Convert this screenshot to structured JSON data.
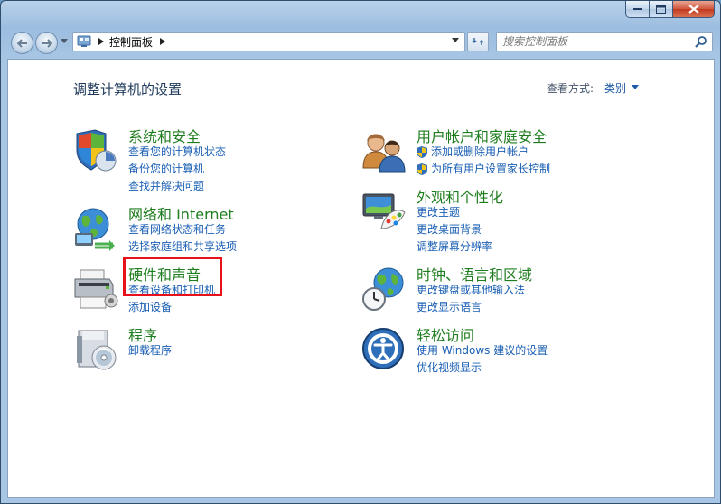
{
  "window": {
    "caption_buttons": [
      "minimize",
      "maximize",
      "close"
    ],
    "accent_close": "#c2391f"
  },
  "address_bar": {
    "breadcrumb": "控制面板"
  },
  "search": {
    "placeholder": "搜索控制面板"
  },
  "header": {
    "title": "调整计算机的设置",
    "view_label": "查看方式:",
    "view_value": "类别"
  },
  "categories_left": [
    {
      "title": "系统和安全",
      "icon": "system-security-icon",
      "links": [
        "查看您的计算机状态",
        "备份您的计算机",
        "查找并解决问题"
      ]
    },
    {
      "title": "网络和 Internet",
      "icon": "network-internet-icon",
      "links": [
        "查看网络状态和任务",
        "选择家庭组和共享选项"
      ]
    },
    {
      "title": "硬件和声音",
      "icon": "hardware-sound-icon",
      "links": [
        "查看设备和打印机",
        "添加设备"
      ]
    },
    {
      "title": "程序",
      "icon": "programs-icon",
      "links": [
        "卸载程序"
      ]
    }
  ],
  "categories_right": [
    {
      "title": "用户帐户和家庭安全",
      "icon": "user-accounts-icon",
      "links": [
        "添加或删除用户帐户",
        "为所有用户设置家长控制"
      ]
    },
    {
      "title": "外观和个性化",
      "icon": "appearance-icon",
      "links": [
        "更改主题",
        "更改桌面背景",
        "调整屏幕分辨率"
      ]
    },
    {
      "title": "时钟、语言和区域",
      "icon": "clock-language-region-icon",
      "links": [
        "更改键盘或其他输入法",
        "更改显示语言"
      ]
    },
    {
      "title": "轻松访问",
      "icon": "ease-of-access-icon",
      "links": [
        "使用 Windows 建议的设置",
        "优化视频显示"
      ]
    }
  ],
  "annotation": {
    "highlight_color": "#e8111a",
    "highlighted_category": "硬件和声音"
  }
}
